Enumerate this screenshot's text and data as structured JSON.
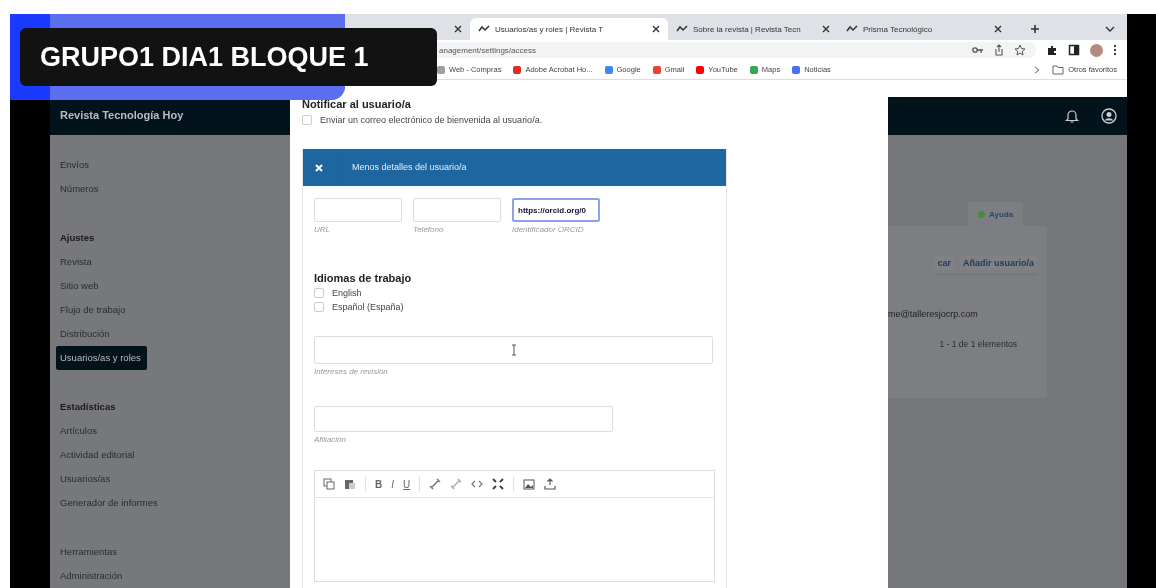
{
  "caption": "GRUPO1 DIA1 BLOQUE 1",
  "browser": {
    "tabs": [
      {
        "selected": false
      },
      {
        "label": "Usuarios/as y roles | Revista T",
        "selected": true
      },
      {
        "label": "Sobre la revista | Revista Tecn",
        "selected": false
      },
      {
        "label": "Prisma Tecnológico",
        "selected": false
      }
    ],
    "url": "anagement/settings/access",
    "bookmarks": [
      {
        "label": "Web - Compras",
        "color": "#9aa0a6"
      },
      {
        "label": "Adobe Acrobat Ho...",
        "color": "#d93025"
      },
      {
        "label": "Google",
        "color": "#4285f4"
      },
      {
        "label": "Gmail",
        "color": "#ea4335"
      },
      {
        "label": "YouTube",
        "color": "#ff0000"
      },
      {
        "label": "Maps",
        "color": "#34a853"
      },
      {
        "label": "Noticias",
        "color": "#4c6ef5"
      }
    ],
    "other_bookmarks": "Otros favoritos"
  },
  "app": {
    "journal": "Revista Tecnología Hoy",
    "sidebar": [
      {
        "items": [
          {
            "label": "Envíos",
            "selected": false
          },
          {
            "label": "Números",
            "selected": false
          }
        ]
      },
      {
        "heading": "Ajustes",
        "items": [
          {
            "label": "Revista",
            "selected": false
          },
          {
            "label": "Sitio web",
            "selected": false
          },
          {
            "label": "Flujo de trabajo",
            "selected": false
          },
          {
            "label": "Distribución",
            "selected": false
          },
          {
            "label": "Usuarios/as y roles",
            "selected": true
          }
        ]
      },
      {
        "heading": "Estadísticas",
        "items": [
          {
            "label": "Artículos",
            "selected": false
          },
          {
            "label": "Actividad editorial",
            "selected": false
          },
          {
            "label": "Usuarios/as",
            "selected": false
          },
          {
            "label": "Generador de informes",
            "selected": false
          }
        ]
      },
      {
        "items": [
          {
            "label": "Herramientas",
            "selected": false
          },
          {
            "label": "Administración",
            "selected": false
          }
        ]
      }
    ],
    "help": "Ayuda",
    "buttons": [
      "car",
      "Añadir usuario/a"
    ],
    "email": "me@talleresjocrp.com",
    "pagination": "1 - 1 de 1 elementos"
  },
  "modal": {
    "notify_heading": "Notificar al usuario/a",
    "notify": {
      "label": "Enviar un correo electrónico de bienvenida al usuario/a.",
      "checked": false
    },
    "panel_title": "Menos detalles del usuario/a",
    "fields": [
      {
        "label": "URL"
      },
      {
        "label": "Teléfono"
      },
      {
        "label": "Identificador ORCID",
        "value": "https://orcid.org/0"
      }
    ],
    "languages_heading": "Idiomas de trabajo",
    "languages": [
      {
        "label": "English",
        "checked": false
      },
      {
        "label": "Español (España)",
        "checked": false
      }
    ],
    "interests": {
      "label": "Intereses de revisión"
    },
    "affiliation": {
      "label": "Afiliación"
    },
    "format_buttons": [
      "B",
      "I",
      "U"
    ]
  }
}
